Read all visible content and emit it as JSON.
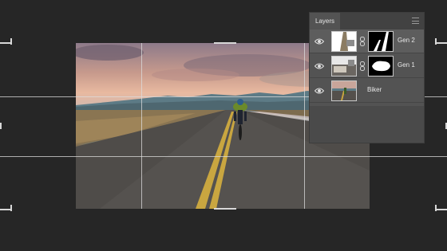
{
  "layers_panel": {
    "tab_label": "Layers",
    "menu_icon": "panel-menu-icon",
    "layers": [
      {
        "name": "Gen 2",
        "visible": true,
        "has_mask": true
      },
      {
        "name": "Gen 1",
        "visible": true,
        "has_mask": true
      },
      {
        "name": "Biker",
        "visible": true,
        "has_mask": false
      }
    ]
  },
  "colors": {
    "workspace_bg": "#262626",
    "panel_bg": "#535353",
    "guide_color": "#dcdcdc"
  }
}
